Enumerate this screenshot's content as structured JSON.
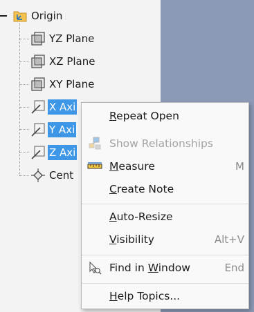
{
  "tree": {
    "origin": {
      "label": "Origin",
      "icon": "origin-folder-icon"
    },
    "items": [
      {
        "label": "YZ Plane",
        "icon": "work-plane-icon",
        "selected": false
      },
      {
        "label": "XZ Plane",
        "icon": "work-plane-icon",
        "selected": false
      },
      {
        "label": "XY Plane",
        "icon": "work-plane-icon",
        "selected": false
      },
      {
        "label": "X Axi",
        "icon": "work-axis-icon",
        "selected": true
      },
      {
        "label": "Y Axi",
        "icon": "work-axis-icon",
        "selected": true
      },
      {
        "label": "Z Axi",
        "icon": "work-axis-icon",
        "selected": true
      },
      {
        "label": "Cent",
        "icon": "work-point-icon",
        "selected": false
      }
    ]
  },
  "context_menu": {
    "items": [
      {
        "id": "repeat_open",
        "label": "Repeat Open",
        "mnemonic": "R",
        "shortcut": "",
        "enabled": true,
        "icon": ""
      },
      {
        "id": "show_relationships",
        "label": "Show Relationships",
        "mnemonic": "",
        "shortcut": "",
        "enabled": false,
        "icon": "relationships-icon"
      },
      {
        "id": "measure",
        "label": "Measure",
        "mnemonic": "M",
        "shortcut": "M",
        "enabled": true,
        "icon": "ruler-icon"
      },
      {
        "id": "create_note",
        "label": "Create Note",
        "mnemonic": "C",
        "shortcut": "",
        "enabled": true,
        "icon": ""
      },
      {
        "id": "auto_resize",
        "label": "Auto-Resize",
        "mnemonic": "A",
        "shortcut": "",
        "enabled": true,
        "icon": ""
      },
      {
        "id": "visibility",
        "label": "Visibility",
        "mnemonic": "V",
        "shortcut": "Alt+V",
        "enabled": true,
        "icon": ""
      },
      {
        "id": "find_in_window",
        "label": "Find in Window",
        "mnemonic": "W",
        "shortcut": "End",
        "enabled": true,
        "icon": "find-cursor-icon"
      },
      {
        "id": "help_topics",
        "label": "Help Topics...",
        "mnemonic": "H",
        "shortcut": "",
        "enabled": true,
        "icon": ""
      }
    ]
  },
  "colors": {
    "selection": "#3d97e6",
    "viewport": "#8d9ab6",
    "panel": "#f3f3f3",
    "menu": "#f9f9f9",
    "disabled_text": "#a3a3a3"
  }
}
